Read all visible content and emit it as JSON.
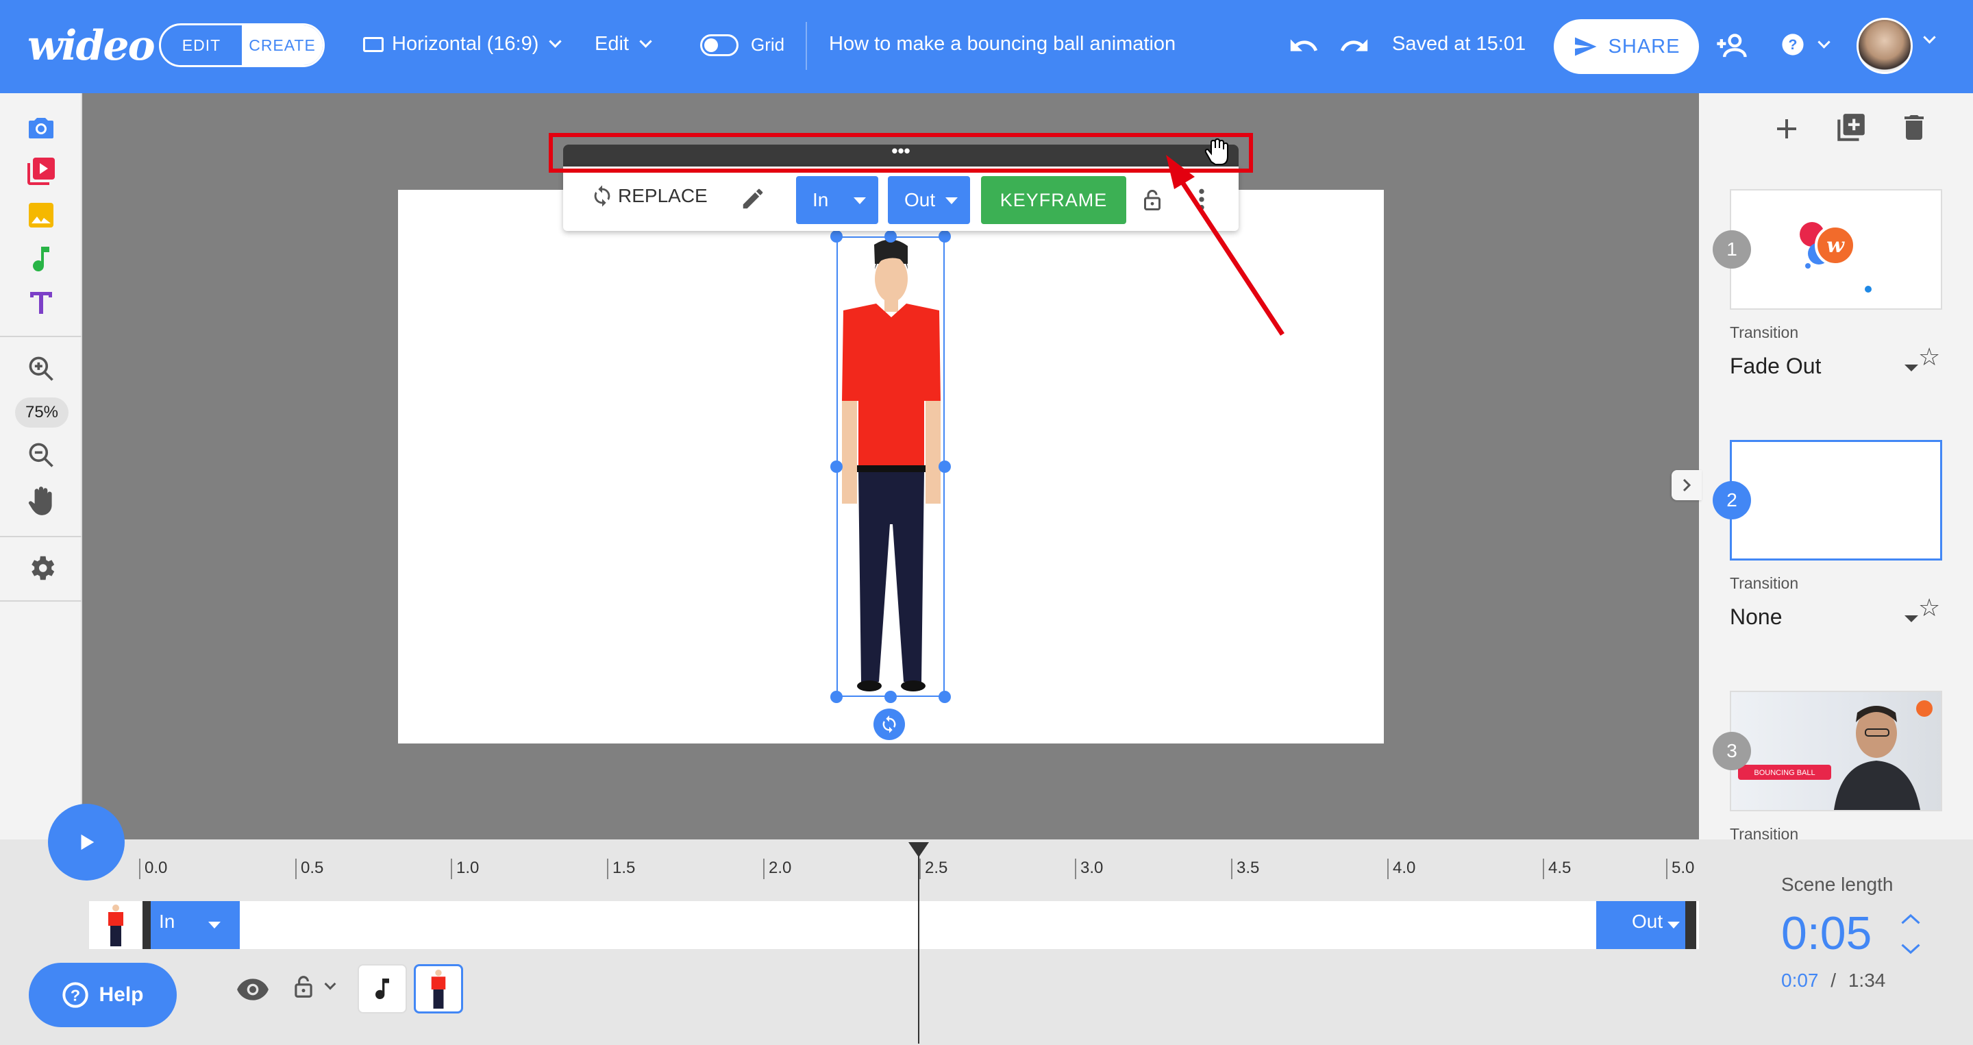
{
  "header": {
    "logo": "wideo",
    "mode_edit": "EDIT",
    "mode_create": "CREATE",
    "format_label": "Horizontal (16:9)",
    "edit_menu": "Edit",
    "grid_label": "Grid",
    "project_title": "How to make a bouncing ball animation",
    "saved_status": "Saved at 15:01",
    "share_label": "SHARE"
  },
  "left_toolbar": {
    "zoom_level": "75%"
  },
  "element_toolbar": {
    "drag_handle": "•••",
    "replace_label": "REPLACE",
    "in_label": "In",
    "out_label": "Out",
    "keyframe_label": "KEYFRAME"
  },
  "scenes": [
    {
      "number": "1",
      "transition_label": "Transition",
      "transition": "Fade Out"
    },
    {
      "number": "2",
      "transition_label": "Transition",
      "transition": "None"
    },
    {
      "number": "3",
      "transition_label": "Transition",
      "thumb_text": "BOUNCING BALL"
    }
  ],
  "timeline": {
    "ticks": [
      "0.0",
      "0.5",
      "1.0",
      "1.5",
      "2.0",
      "2.5",
      "3.0",
      "3.5",
      "4.0",
      "4.5",
      "5.0"
    ],
    "in_label": "In",
    "out_label": "Out",
    "help_label": "Help",
    "scene_length_label": "Scene length",
    "scene_length_value": "0:05",
    "current_time": "0:07",
    "time_separator": "/",
    "total_time": "1:34"
  },
  "colors": {
    "primary": "#4287f5",
    "keyframe": "#3cb054",
    "highlight": "#e3000f"
  }
}
